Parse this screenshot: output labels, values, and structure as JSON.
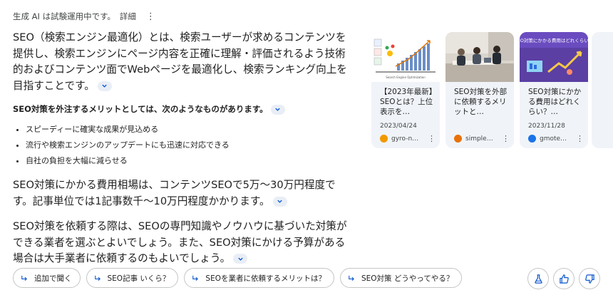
{
  "header": {
    "label": "生成 AI は試験運用中です。",
    "detail_link": "詳細",
    "menu_icon": "more-vert-icon"
  },
  "overview": {
    "intro": "SEO（検索エンジン最適化）とは、検索ユーザーが求めるコンテンツを提供し、検索エンジンにページ内容を正確に理解・評価されるよう技術的およびコンテンツ面でWebページを最適化し、検索ランキング向上を目指すことです。",
    "merits_heading": "SEO対策を外注するメリットとしては、次のようなものがあります。",
    "merits": [
      "スピーディーに確実な成果が見込める",
      "流行や検索エンジンのアップデートにも迅速に対応できる",
      "自社の負担を大幅に減らせる"
    ],
    "cost": "SEO対策にかかる費用相場は、コンテンツSEOで5万～30万円程度です。記事単位では1記事数千～10万円程度かかります。",
    "advice": "SEO対策を依頼する際は、SEOの専門知識やノウハウに基づいた対策ができる業者を選ぶとよいでしょう。また、SEO対策にかける予算がある場合は大手業者に依頼するのもよいでしょう。"
  },
  "cards": [
    {
      "title": "【2023年最新】SEOとは？上位表示を…",
      "thumb_caption": "Search Engine Optimization",
      "date": "2023/04/24",
      "source": "gyro-n…",
      "favicon_color": "#f29900"
    },
    {
      "title": "SEO対策を外部に依頼するメリットと…",
      "date": "",
      "source": "simple…",
      "favicon_color": "#e8710a"
    },
    {
      "title": "SEO対策にかかる費用はどれくらい？…",
      "thumb_caption": "SEO対策にかかる費用はどれくらい？",
      "date": "2023/11/28",
      "source": "gmote…",
      "favicon_color": "#1a73e8"
    }
  ],
  "followups": [
    {
      "label": "追加で聞く"
    },
    {
      "label": "SEO記事 いくら？"
    },
    {
      "label": "SEOを業者に依頼するメリットは？"
    },
    {
      "label": "SEO対策 どうやってやる？"
    }
  ],
  "feedback": {
    "labs_icon": "flask-icon",
    "thumbs_up_icon": "thumbs-up-icon",
    "thumbs_down_icon": "thumbs-down-icon"
  },
  "colors": {
    "accent": "#0b57d0",
    "card_bg": "#f0f4f9",
    "chip_border": "#c4c7c5"
  }
}
